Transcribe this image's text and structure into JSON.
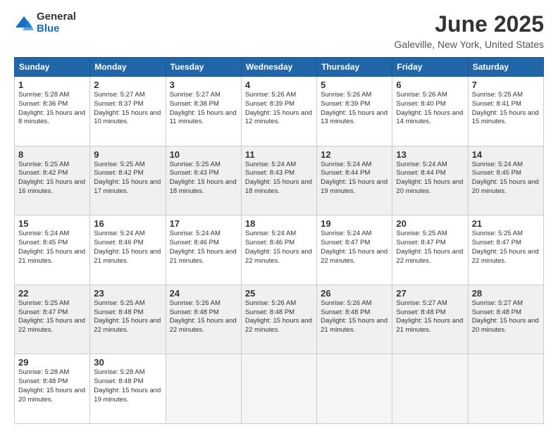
{
  "header": {
    "logo_general": "General",
    "logo_blue": "Blue",
    "month_title": "June 2025",
    "location": "Galeville, New York, United States"
  },
  "days_of_week": [
    "Sunday",
    "Monday",
    "Tuesday",
    "Wednesday",
    "Thursday",
    "Friday",
    "Saturday"
  ],
  "weeks": [
    [
      {
        "num": "1",
        "sunrise": "5:28 AM",
        "sunset": "8:36 PM",
        "daylight": "15 hours and 8 minutes."
      },
      {
        "num": "2",
        "sunrise": "5:27 AM",
        "sunset": "8:37 PM",
        "daylight": "15 hours and 10 minutes."
      },
      {
        "num": "3",
        "sunrise": "5:27 AM",
        "sunset": "8:38 PM",
        "daylight": "15 hours and 11 minutes."
      },
      {
        "num": "4",
        "sunrise": "5:26 AM",
        "sunset": "8:39 PM",
        "daylight": "15 hours and 12 minutes."
      },
      {
        "num": "5",
        "sunrise": "5:26 AM",
        "sunset": "8:39 PM",
        "daylight": "15 hours and 13 minutes."
      },
      {
        "num": "6",
        "sunrise": "5:26 AM",
        "sunset": "8:40 PM",
        "daylight": "15 hours and 14 minutes."
      },
      {
        "num": "7",
        "sunrise": "5:25 AM",
        "sunset": "8:41 PM",
        "daylight": "15 hours and 15 minutes."
      }
    ],
    [
      {
        "num": "8",
        "sunrise": "5:25 AM",
        "sunset": "8:42 PM",
        "daylight": "15 hours and 16 minutes."
      },
      {
        "num": "9",
        "sunrise": "5:25 AM",
        "sunset": "8:42 PM",
        "daylight": "15 hours and 17 minutes."
      },
      {
        "num": "10",
        "sunrise": "5:25 AM",
        "sunset": "8:43 PM",
        "daylight": "15 hours and 18 minutes."
      },
      {
        "num": "11",
        "sunrise": "5:24 AM",
        "sunset": "8:43 PM",
        "daylight": "15 hours and 18 minutes."
      },
      {
        "num": "12",
        "sunrise": "5:24 AM",
        "sunset": "8:44 PM",
        "daylight": "15 hours and 19 minutes."
      },
      {
        "num": "13",
        "sunrise": "5:24 AM",
        "sunset": "8:44 PM",
        "daylight": "15 hours and 20 minutes."
      },
      {
        "num": "14",
        "sunrise": "5:24 AM",
        "sunset": "8:45 PM",
        "daylight": "15 hours and 20 minutes."
      }
    ],
    [
      {
        "num": "15",
        "sunrise": "5:24 AM",
        "sunset": "8:45 PM",
        "daylight": "15 hours and 21 minutes."
      },
      {
        "num": "16",
        "sunrise": "5:24 AM",
        "sunset": "8:46 PM",
        "daylight": "15 hours and 21 minutes."
      },
      {
        "num": "17",
        "sunrise": "5:24 AM",
        "sunset": "8:46 PM",
        "daylight": "15 hours and 21 minutes."
      },
      {
        "num": "18",
        "sunrise": "5:24 AM",
        "sunset": "8:46 PM",
        "daylight": "15 hours and 22 minutes."
      },
      {
        "num": "19",
        "sunrise": "5:24 AM",
        "sunset": "8:47 PM",
        "daylight": "15 hours and 22 minutes."
      },
      {
        "num": "20",
        "sunrise": "5:25 AM",
        "sunset": "8:47 PM",
        "daylight": "15 hours and 22 minutes."
      },
      {
        "num": "21",
        "sunrise": "5:25 AM",
        "sunset": "8:47 PM",
        "daylight": "15 hours and 22 minutes."
      }
    ],
    [
      {
        "num": "22",
        "sunrise": "5:25 AM",
        "sunset": "8:47 PM",
        "daylight": "15 hours and 22 minutes."
      },
      {
        "num": "23",
        "sunrise": "5:25 AM",
        "sunset": "8:48 PM",
        "daylight": "15 hours and 22 minutes."
      },
      {
        "num": "24",
        "sunrise": "5:26 AM",
        "sunset": "8:48 PM",
        "daylight": "15 hours and 22 minutes."
      },
      {
        "num": "25",
        "sunrise": "5:26 AM",
        "sunset": "8:48 PM",
        "daylight": "15 hours and 22 minutes."
      },
      {
        "num": "26",
        "sunrise": "5:26 AM",
        "sunset": "8:48 PM",
        "daylight": "15 hours and 21 minutes."
      },
      {
        "num": "27",
        "sunrise": "5:27 AM",
        "sunset": "8:48 PM",
        "daylight": "15 hours and 21 minutes."
      },
      {
        "num": "28",
        "sunrise": "5:27 AM",
        "sunset": "8:48 PM",
        "daylight": "15 hours and 20 minutes."
      }
    ],
    [
      {
        "num": "29",
        "sunrise": "5:28 AM",
        "sunset": "8:48 PM",
        "daylight": "15 hours and 20 minutes."
      },
      {
        "num": "30",
        "sunrise": "5:28 AM",
        "sunset": "8:48 PM",
        "daylight": "15 hours and 19 minutes."
      },
      null,
      null,
      null,
      null,
      null
    ]
  ]
}
